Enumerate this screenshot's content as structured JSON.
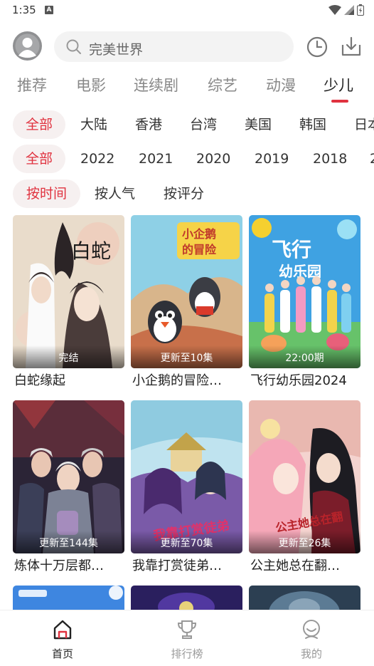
{
  "status": {
    "time": "1:35",
    "notification_letter": "A"
  },
  "search": {
    "placeholder": "完美世界"
  },
  "category_tabs": [
    "推荐",
    "电影",
    "连续剧",
    "综艺",
    "动漫",
    "少儿"
  ],
  "region_filters": [
    "全部",
    "大陆",
    "香港",
    "台湾",
    "美国",
    "韩国",
    "日本"
  ],
  "year_filters": [
    "全部",
    "2022",
    "2021",
    "2020",
    "2019",
    "2018",
    "2"
  ],
  "sort_filters": [
    "按时间",
    "按人气",
    "按评分"
  ],
  "cards": [
    {
      "title": "白蛇缘起",
      "badge": "完结"
    },
    {
      "title": "小企鹅的冒险…",
      "badge": "更新至10集"
    },
    {
      "title": "飞行幼乐园2024",
      "badge": "22:00期"
    },
    {
      "title": "炼体十万层都…",
      "badge": "更新至144集"
    },
    {
      "title": "我靠打赏徒弟…",
      "badge": "更新至70集"
    },
    {
      "title": "公主她总在翻…",
      "badge": "更新至26集"
    }
  ],
  "poster_text": {
    "p1": "白蛇",
    "p2": "小企鹅\n的冒险",
    "p3_line1": "飞行",
    "p3_line2": "幼乐园",
    "p5": "我靠打赏徒弟",
    "p6": "公主她总在翻"
  },
  "bottom_nav": [
    {
      "label": "首页",
      "icon": "home-icon",
      "active": true
    },
    {
      "label": "排行榜",
      "icon": "trophy-icon",
      "active": false
    },
    {
      "label": "我的",
      "icon": "profile-icon",
      "active": false
    }
  ],
  "colors": {
    "accent": "#e0323f",
    "chip_bg": "#f6f0f0",
    "search_bg": "#f3f3f3"
  }
}
